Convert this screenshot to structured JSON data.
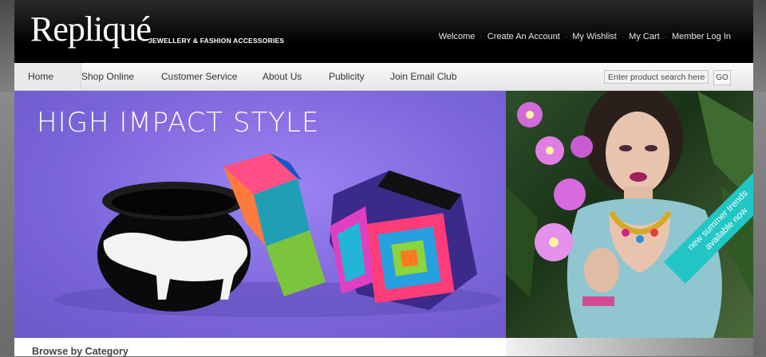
{
  "brand": {
    "logo_text": "Repliqué",
    "tagline": "JEWELLERY & FASHION ACCESSORIES"
  },
  "top_links": [
    "Welcome",
    "Create An Account",
    "My Wishlist",
    "My Cart",
    "Member Log In"
  ],
  "nav": {
    "items": [
      "Home",
      "Shop Online",
      "Customer Service",
      "About Us",
      "Publicity",
      "Join Email Club"
    ],
    "active": "Home",
    "search_value": "Enter product search here",
    "go_label": "GO"
  },
  "banner_main": {
    "headline": "HIGH IMPACT STYLE"
  },
  "banner_side": {
    "ribbon_line1": "new summer trends",
    "ribbon_line2": "available now"
  },
  "browse": {
    "title": "Browse by Category"
  },
  "colors": {
    "accent_ribbon": "#22c6c4",
    "banner_purple": "#8a74e6",
    "header_black": "#000000"
  }
}
